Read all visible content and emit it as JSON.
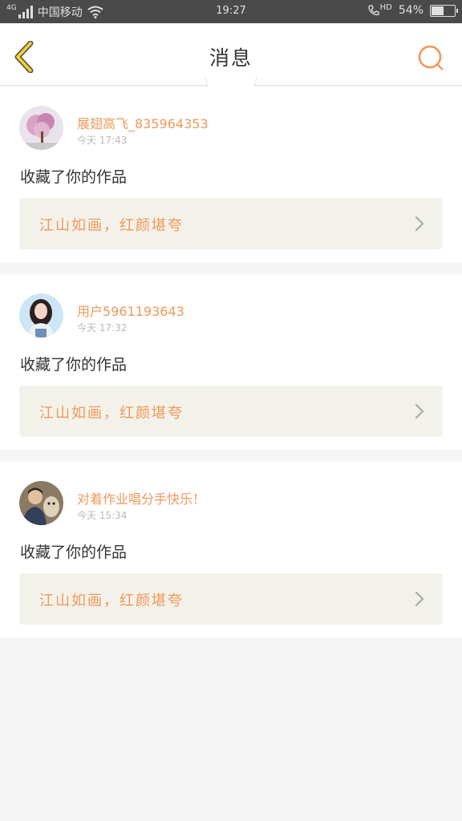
{
  "status_bar": {
    "network": "4G",
    "carrier": "中国移动",
    "time": "19:27",
    "hd": "HD",
    "battery": "54%",
    "battery_level": 0.54
  },
  "header": {
    "title": "消息",
    "back_icon": "chevron-left-icon",
    "search_icon": "search-icon"
  },
  "colors": {
    "accent": "#f0985a",
    "back_arrow": "#f5d327",
    "card_link_bg": "#f3f2ea"
  },
  "messages": [
    {
      "username": "展翅高飞_835964353",
      "time": "今天 17:43",
      "action": "收藏了你的作品",
      "work_title": "江山如画，红颜堪夸"
    },
    {
      "username": "用户5961193643",
      "time": "今天 17:32",
      "action": "收藏了你的作品",
      "work_title": "江山如画，红颜堪夸"
    },
    {
      "username": "对着作业唱分手快乐！",
      "time": "今天 15:34",
      "action": "收藏了你的作品",
      "work_title": "江山如画，红颜堪夸"
    }
  ]
}
